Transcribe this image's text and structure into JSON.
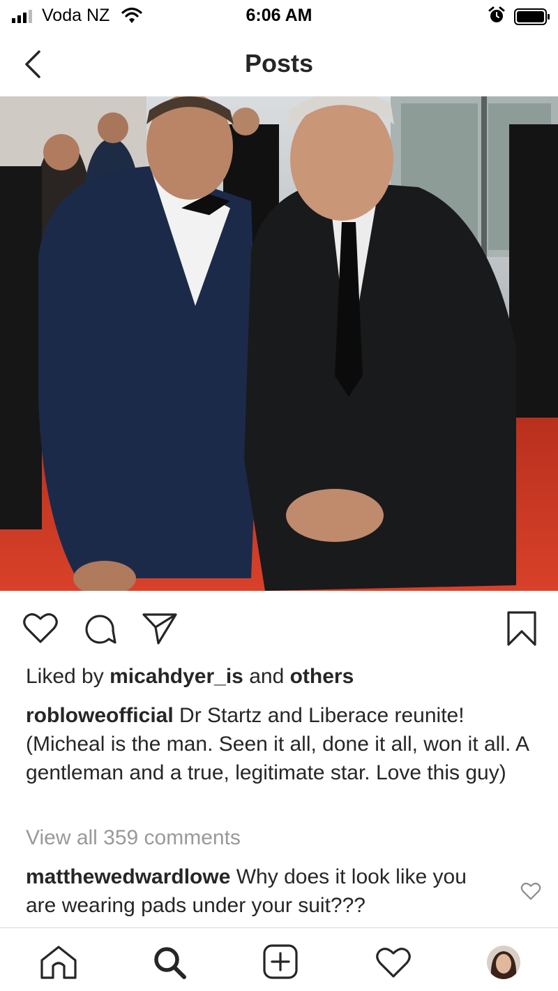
{
  "status": {
    "carrier": "Voda NZ",
    "time": "6:06 AM",
    "icons": [
      "signal-icon",
      "wifi-icon",
      "alarm-icon",
      "battery-icon"
    ]
  },
  "header": {
    "title": "Posts",
    "back_icon": "chevron-left-icon"
  },
  "post": {
    "photo": "photo of two men in black-tie suits on a red carpet",
    "actions": [
      "heart-icon",
      "comment-icon",
      "share-icon",
      "bookmark-icon"
    ],
    "likes": {
      "prefix": "Liked by ",
      "user": "micahdyer_is",
      "middle": " and ",
      "others": "others"
    },
    "caption": {
      "username": "robloweofficial",
      "text": " Dr Startz and Liberace reunite! (Micheal is the man. Seen it all, done it all, won it all. A gentleman and a true, legitimate star. Love this guy)"
    },
    "view_all_comments": "View all 359 comments",
    "comments": [
      {
        "username": "matthewedwardlowe",
        "text": " Why does it look like you are wearing pads under your suit???"
      }
    ]
  },
  "tab_bar": {
    "tabs": [
      "home-icon",
      "search-icon",
      "new-post-icon",
      "activity-icon",
      "profile-avatar"
    ]
  },
  "colors": {
    "text": "#262626",
    "muted": "#999999",
    "divider": "#dbdbdb",
    "carpet": "#c8321f",
    "suit_navy": "#1c2a4a"
  }
}
